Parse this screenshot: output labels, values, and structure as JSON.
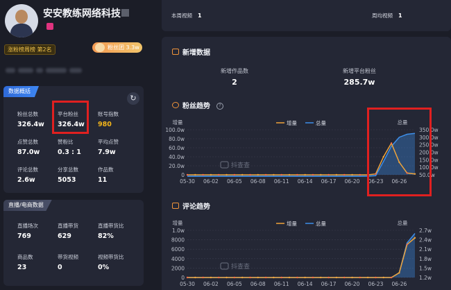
{
  "profile": {
    "name": "安安教练网络科技",
    "rank_badge": "涨粉榜周榜 第2名",
    "fans_group": "粉丝团 3.3w"
  },
  "overview": {
    "tag": "数据概括",
    "stats": [
      {
        "label": "粉丝总数",
        "value": "326.4w"
      },
      {
        "label": "平台粉丝",
        "value": "326.4w"
      },
      {
        "label": "账号指数",
        "value": "980"
      },
      {
        "label": "点赞总数",
        "value": "87.0w"
      },
      {
        "label": "赞粉比",
        "value": "0.3 : 1"
      },
      {
        "label": "平均点赞",
        "value": "7.9w"
      },
      {
        "label": "评论总数",
        "value": "2.6w"
      },
      {
        "label": "分享总数",
        "value": "5053"
      },
      {
        "label": "作品数",
        "value": "11"
      }
    ]
  },
  "live": {
    "tag": "直播/电商数据",
    "stats": [
      {
        "label": "直播场次",
        "value": "769"
      },
      {
        "label": "直播带货",
        "value": "629"
      },
      {
        "label": "直播带货比",
        "value": "82%"
      },
      {
        "label": "商品数",
        "value": "23"
      },
      {
        "label": "带货视频",
        "value": "0"
      },
      {
        "label": "视频带货比",
        "value": "0%"
      }
    ]
  },
  "top": {
    "this_week_label": "本周视频",
    "this_week_value": "1",
    "weekly_avg_label": "周均视频",
    "weekly_avg_value": "1"
  },
  "new_data": {
    "title": "新增数据",
    "works_label": "新增作品数",
    "works_value": "2",
    "fans_label": "新增平台粉丝",
    "fans_value": "285.7w"
  },
  "fans_trend_title": "粉丝趋势",
  "comment_trend_title": "评论趋势",
  "watermark": "抖查查",
  "colors": {
    "increase": "#f0a43a",
    "total": "#3d8fea",
    "highlight": "#e02020"
  },
  "chart_data": [
    {
      "type": "line",
      "title": "粉丝趋势",
      "x": [
        "05-30",
        "05-31",
        "06-01",
        "06-02",
        "06-03",
        "06-04",
        "06-05",
        "06-06",
        "06-07",
        "06-08",
        "06-09",
        "06-10",
        "06-11",
        "06-12",
        "06-13",
        "06-14",
        "06-15",
        "06-16",
        "06-17",
        "06-18",
        "06-19",
        "06-20",
        "06-21",
        "06-22",
        "06-23",
        "06-24",
        "06-25",
        "06-26",
        "06-27",
        "06-28"
      ],
      "x_tick_labels": [
        "05-30",
        "06-02",
        "06-05",
        "06-08",
        "06-11",
        "06-14",
        "06-17",
        "06-20",
        "06-23",
        "06-26"
      ],
      "ylabel_left": "增量",
      "ylabel_right": "总量",
      "y_left_ticks": [
        "100.0w",
        "80.0w",
        "60.0w",
        "40.0w",
        "20.0w",
        "0"
      ],
      "y_right_ticks": [
        "350.0w",
        "300.0w",
        "250.0w",
        "200.0w",
        "150.0w",
        "100.0w",
        "50.0w"
      ],
      "ylim_left": [
        0,
        100
      ],
      "ylim_right": [
        50,
        350
      ],
      "series": [
        {
          "name": "增量",
          "axis": "left",
          "values": [
            0,
            0,
            0,
            0,
            0,
            0,
            0,
            0,
            0,
            0,
            0,
            0,
            0,
            0,
            0,
            0,
            0,
            0,
            0,
            0,
            0,
            0,
            0,
            0,
            2,
            40,
            70,
            28,
            4,
            2
          ]
        },
        {
          "name": "总量",
          "axis": "right",
          "values": [
            40,
            40,
            40,
            40,
            40,
            40,
            40,
            40,
            40,
            40,
            40,
            40,
            40,
            40,
            40,
            40,
            40,
            40,
            40,
            40,
            40,
            40,
            40,
            41,
            44,
            140,
            240,
            300,
            320,
            326
          ]
        }
      ]
    },
    {
      "type": "line",
      "title": "评论趋势",
      "x": [
        "05-30",
        "05-31",
        "06-01",
        "06-02",
        "06-03",
        "06-04",
        "06-05",
        "06-06",
        "06-07",
        "06-08",
        "06-09",
        "06-10",
        "06-11",
        "06-12",
        "06-13",
        "06-14",
        "06-15",
        "06-16",
        "06-17",
        "06-18",
        "06-19",
        "06-20",
        "06-21",
        "06-22",
        "06-23",
        "06-24",
        "06-25",
        "06-26",
        "06-27",
        "06-28"
      ],
      "x_tick_labels": [
        "05-30",
        "06-02",
        "06-05",
        "06-08",
        "06-11",
        "06-14",
        "06-17",
        "06-20",
        "06-23",
        "06-26"
      ],
      "ylabel_left": "增量",
      "ylabel_right": "总量",
      "y_left_ticks": [
        "1.0w",
        "8000",
        "6000",
        "4000",
        "2000",
        "0"
      ],
      "y_right_ticks": [
        "2.7w",
        "2.4w",
        "2.1w",
        "1.8w",
        "1.5w",
        "1.2w"
      ],
      "ylim_left": [
        0,
        10000
      ],
      "ylim_right": [
        1.2,
        2.7
      ],
      "series": [
        {
          "name": "增量",
          "axis": "left",
          "values": [
            0,
            0,
            0,
            0,
            0,
            0,
            0,
            0,
            0,
            0,
            0,
            0,
            0,
            0,
            0,
            0,
            0,
            0,
            0,
            0,
            0,
            0,
            0,
            0,
            0,
            0,
            0,
            1000,
            7000,
            8400
          ]
        },
        {
          "name": "总量",
          "axis": "right",
          "values": [
            1.2,
            1.2,
            1.2,
            1.2,
            1.2,
            1.2,
            1.2,
            1.2,
            1.2,
            1.2,
            1.2,
            1.2,
            1.2,
            1.2,
            1.2,
            1.2,
            1.2,
            1.2,
            1.2,
            1.2,
            1.2,
            1.2,
            1.2,
            1.2,
            1.2,
            1.2,
            1.2,
            1.35,
            2.3,
            2.6
          ]
        }
      ]
    }
  ]
}
